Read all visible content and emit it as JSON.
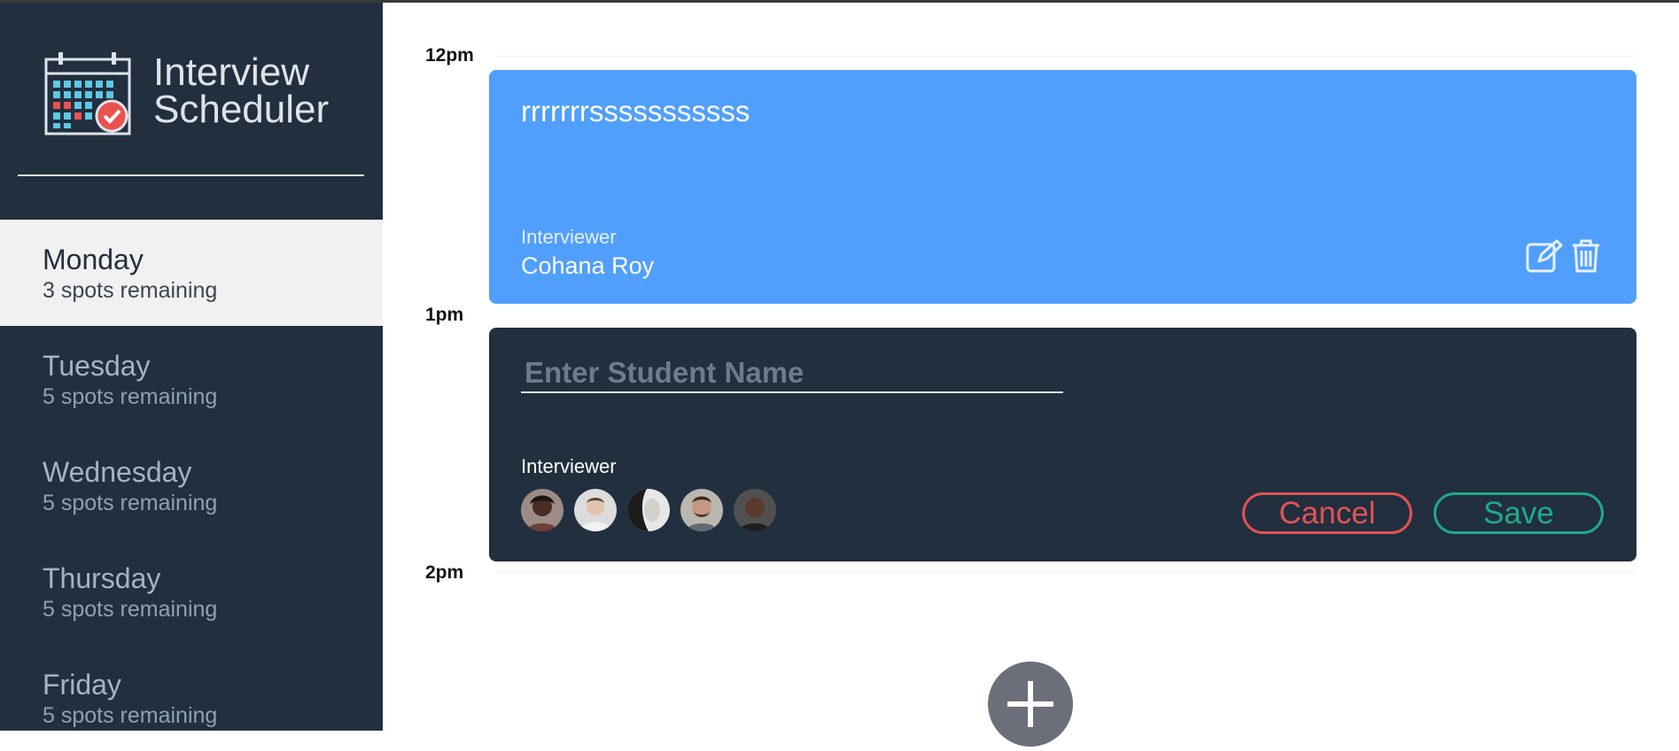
{
  "app": {
    "title_line1": "Interview",
    "title_line2": "Scheduler"
  },
  "days": [
    {
      "name": "Monday",
      "spots": "3 spots remaining",
      "selected": true
    },
    {
      "name": "Tuesday",
      "spots": "5 spots remaining"
    },
    {
      "name": "Wednesday",
      "spots": "5 spots remaining"
    },
    {
      "name": "Thursday",
      "spots": "5 spots remaining"
    },
    {
      "name": "Friday",
      "spots": "5 spots remaining"
    }
  ],
  "times": [
    "12pm",
    "1pm",
    "2pm"
  ],
  "appointment": {
    "student": "rrrrrrrsssssssssss",
    "interviewer_label": "Interviewer",
    "interviewer_name": "Cohana Roy",
    "icons": [
      "edit-icon",
      "trash-icon"
    ]
  },
  "form": {
    "placeholder": "Enter Student Name",
    "value": "",
    "interviewer_label": "Interviewer",
    "avatars": [
      "interviewer-avatar-1",
      "interviewer-avatar-2",
      "interviewer-avatar-3",
      "interviewer-avatar-4",
      "interviewer-avatar-5"
    ],
    "cancel_label": "Cancel",
    "save_label": "Save"
  },
  "add_button": {
    "icon": "plus-icon"
  },
  "colors": {
    "sidebar": "#222f3e",
    "appointment_card": "#519ffc",
    "form_card": "#222f3e",
    "cancel": "#e05454",
    "save": "#1fa98b",
    "selected_day": "#f1f1f1"
  }
}
